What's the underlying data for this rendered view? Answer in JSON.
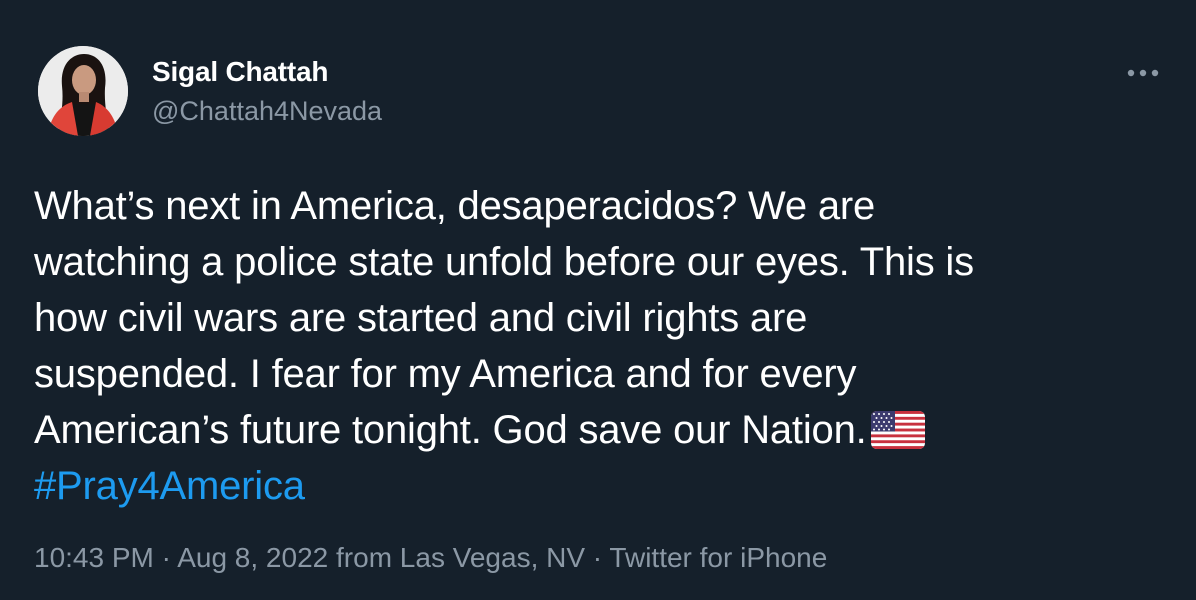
{
  "author": {
    "display_name": "Sigal Chattah",
    "handle": "@Chattah4Nevada"
  },
  "tweet": {
    "lines": [
      "What’s next in America, desaperacidos? We are",
      "watching a police state unfold before our eyes. This is",
      "how civil wars are started and civil rights are",
      "suspended. I fear for my America and for every",
      "American’s future tonight. God save our Nation."
    ],
    "flag_icon": "us-flag-emoji",
    "hashtag": "#Pray4America"
  },
  "meta": {
    "time": "10:43 PM",
    "separator_1": " · ",
    "date": "Aug 8, 2022",
    "location": " from Las Vegas, NV",
    "separator_2": " · ",
    "client": "Twitter for iPhone"
  },
  "icons": {
    "more": "more-horizontal-icon"
  },
  "colors": {
    "background": "#15202b",
    "text": "#ffffff",
    "secondary_text": "#8b98a5",
    "link": "#1d9bf0"
  }
}
